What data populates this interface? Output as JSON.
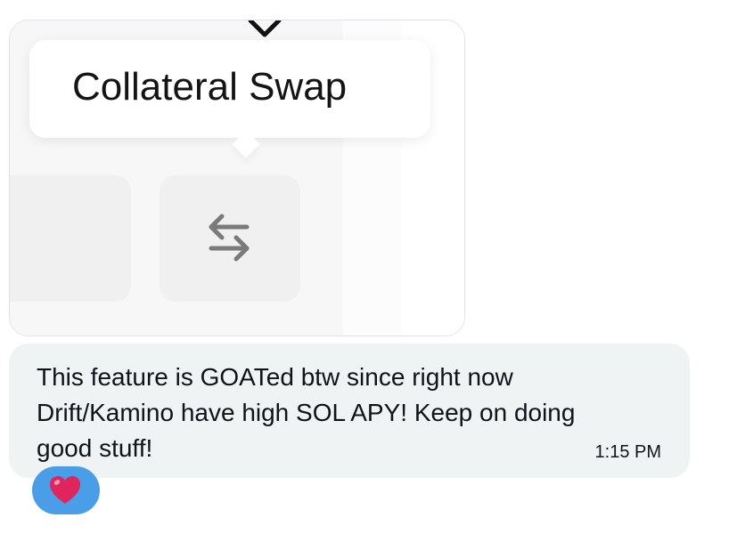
{
  "media": {
    "tooltip_label": "Collateral Swap",
    "icons": [
      "chevron-down-icon",
      "swap-arrows-icon"
    ]
  },
  "message": {
    "text": "This feature is GOATed btw since right now Drift/Kamino have high SOL APY! Keep on doing good stuff!",
    "time": "1:15 PM"
  },
  "reaction": {
    "icon": "heart-icon",
    "pill_color": "#4a9ee8",
    "heart_color": "#e0245e"
  },
  "colors": {
    "bubble_bg": "#eff3f4",
    "text": "#0f1419"
  }
}
